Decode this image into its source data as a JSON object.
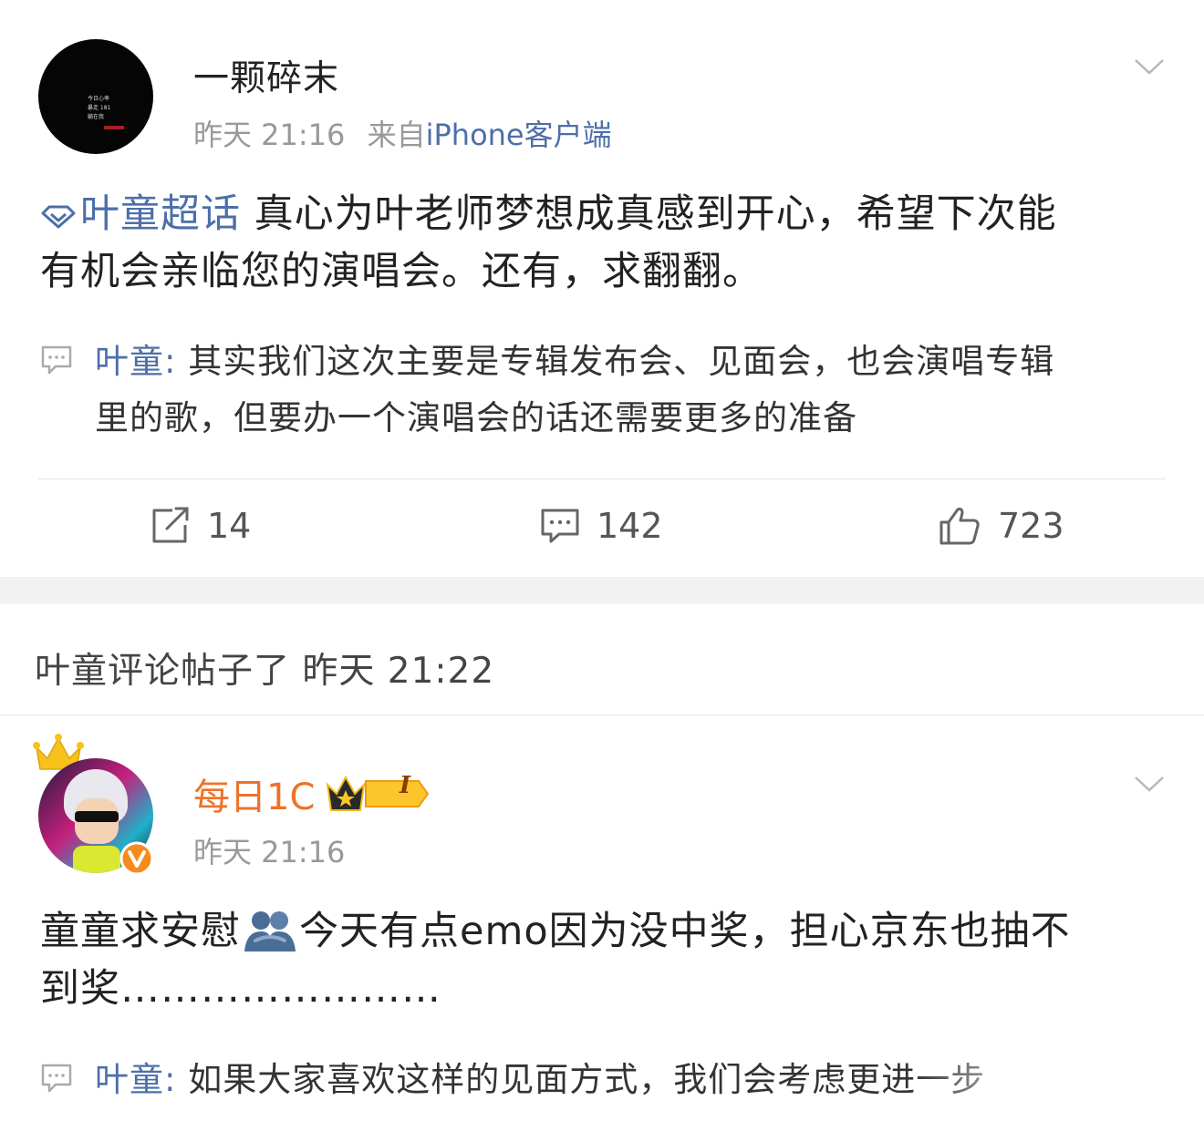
{
  "post1": {
    "user_name": "一颗碎末",
    "time": "昨天 21:16",
    "from_prefix": "来自",
    "source": "iPhone客户端",
    "topic": "叶童超话",
    "content_line1": "真心为叶老师梦想成真感到开心，希望下次能",
    "content_line2": "有机会亲临您的演唱会。还有，求翻翻。",
    "reply_author": "叶童",
    "reply_line1": "其实我们这次主要是专辑发布会、见面会，也会演唱专辑",
    "reply_line2": "里的歌，但要办一个演唱会的话还需要更多的准备",
    "reposts": "14",
    "comments": "142",
    "likes": "723",
    "avatar_text": [
      "今日心率",
      "暴走 181",
      "躺在我"
    ]
  },
  "notice": "叶童评论帖子了 昨天 21:22",
  "post2": {
    "user_name": "每日1C",
    "badge_level": "I",
    "time": "昨天 21:16",
    "content_line1a": "童童求安慰",
    "content_line1b": "今天有点emo因为没中奖，担心京东也抽不",
    "content_line2": "到奖……………………",
    "reply_author": "叶童",
    "reply_line1": "如果大家喜欢这样的见面方式，我们会考虑更进一步"
  },
  "colors": {
    "link_blue": "#4d6fa8",
    "vip_orange": "#ec7328",
    "meta_gray": "#999999",
    "band_gray": "#f2f2f2"
  },
  "icons": [
    "diamond-icon",
    "chevron-down-icon",
    "comment-icon",
    "repost-icon",
    "like-icon",
    "crown-icon",
    "verified-icon",
    "hug-emoji-icon"
  ]
}
